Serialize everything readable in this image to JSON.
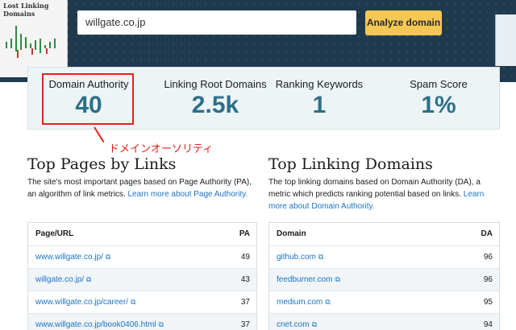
{
  "header": {
    "thumbnail_title": "Lost Linking Domains",
    "search_value": "willgate.co.jp",
    "analyze_label": "Analyze domain"
  },
  "metrics": [
    {
      "label": "Domain Authority",
      "value": "40"
    },
    {
      "label": "Linking Root Domains",
      "value": "2.5k"
    },
    {
      "label": "Ranking Keywords",
      "value": "1"
    },
    {
      "label": "Spam Score",
      "value": "1%"
    }
  ],
  "annotation": {
    "text": "ドメインオーソリティ",
    "color": "#e5211a"
  },
  "top_pages": {
    "title": "Top Pages by Links",
    "desc": "The site's most important pages based on Page Authority (PA), an algorithm of link metrics.",
    "link": "Learn more about Page Authority.",
    "headers": [
      "Page/URL",
      "PA"
    ],
    "rows": [
      {
        "url": "www.willgate.co.jp/",
        "pa": "49"
      },
      {
        "url": "willgate.co.jp/",
        "pa": "43"
      },
      {
        "url": "www.willgate.co.jp/career/",
        "pa": "37"
      },
      {
        "url": "www.willgate.co.jp/book0406.html",
        "pa": "37"
      }
    ]
  },
  "top_domains": {
    "title": "Top Linking Domains",
    "desc": "The top linking domains based on Domain Authority (DA), a metric which predicts ranking potential based on links.",
    "link": "Learn more about Domain Authority.",
    "headers": [
      "Domain",
      "DA"
    ],
    "rows": [
      {
        "domain": "github.com",
        "da": "96"
      },
      {
        "domain": "feedburner.com",
        "da": "96"
      },
      {
        "domain": "medium.com",
        "da": "95"
      },
      {
        "domain": "cnet.com",
        "da": "94"
      }
    ]
  },
  "colors": {
    "accent": "#2e6f88",
    "button": "#f5c754",
    "header_bg": "#1f3a4f",
    "link": "#1a73c5"
  },
  "icons": {
    "external_link": "external-link-icon"
  }
}
